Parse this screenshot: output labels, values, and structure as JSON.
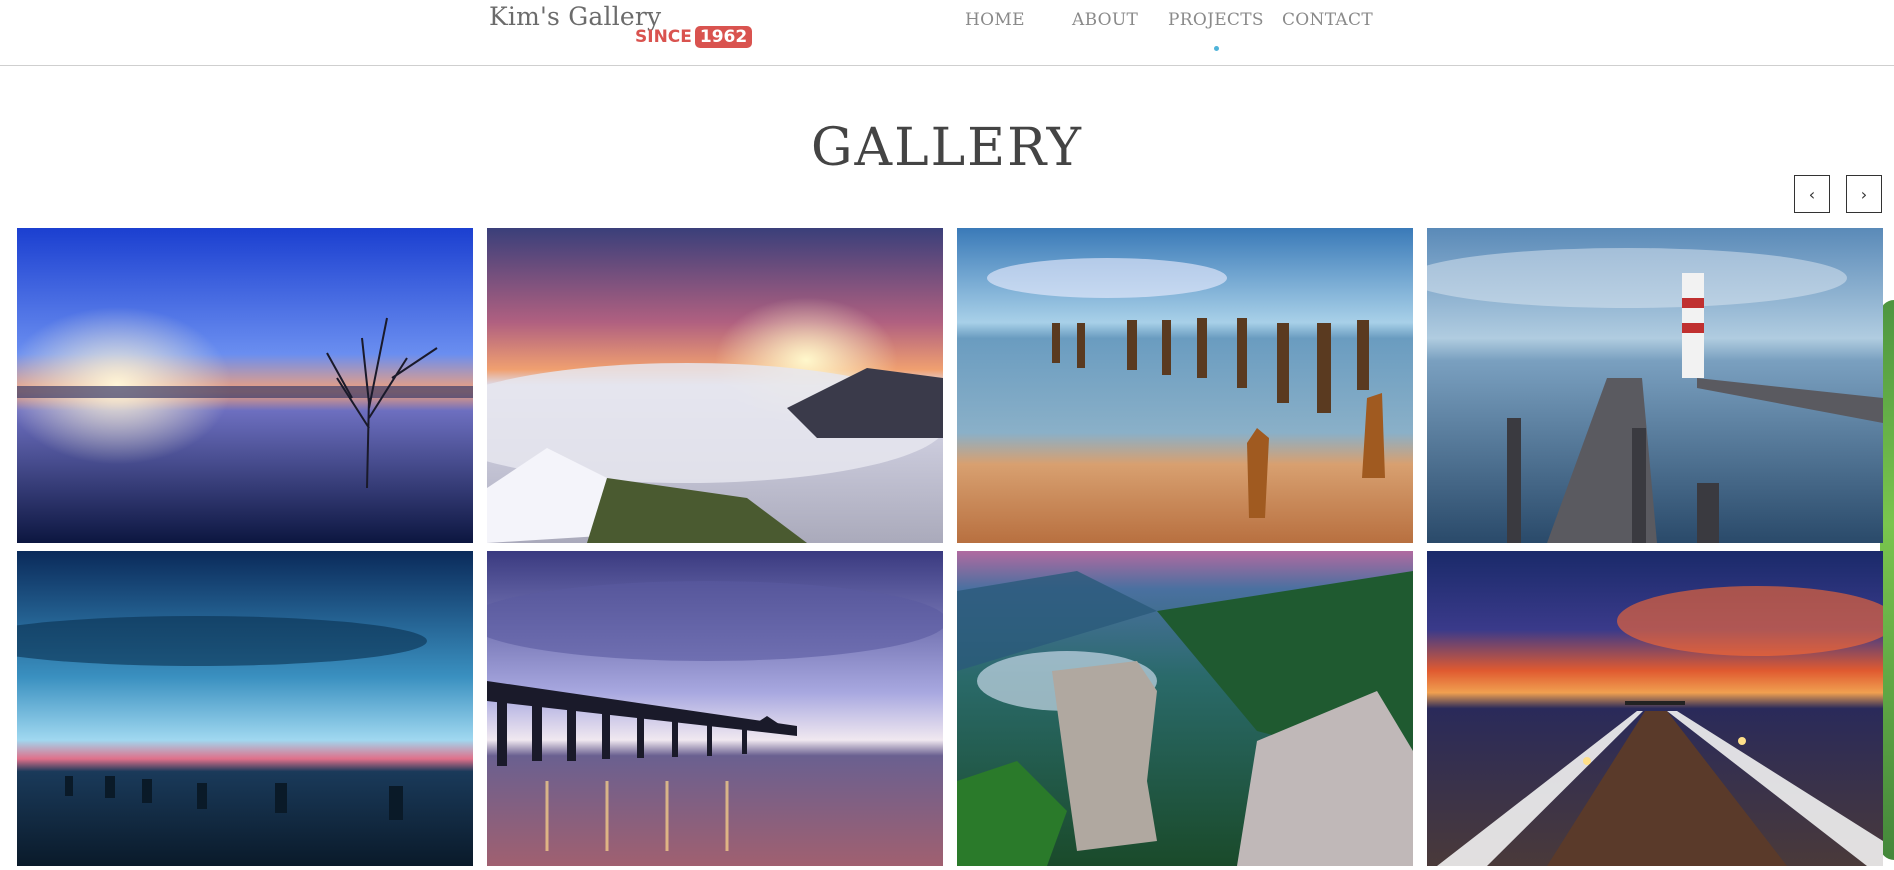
{
  "logo": {
    "title": "Kim's Gallery",
    "since": "SINCE",
    "year": "1962"
  },
  "nav": [
    "HOME",
    "ABOUT",
    "PROJECTS",
    "CONTACT"
  ],
  "nav_active": "PROJECTS",
  "page_title": "GALLERY",
  "carousel": {
    "prev": "‹",
    "next": "›"
  },
  "colors": {
    "accent": "#d9534f",
    "active_dot": "#4fb3d9"
  }
}
